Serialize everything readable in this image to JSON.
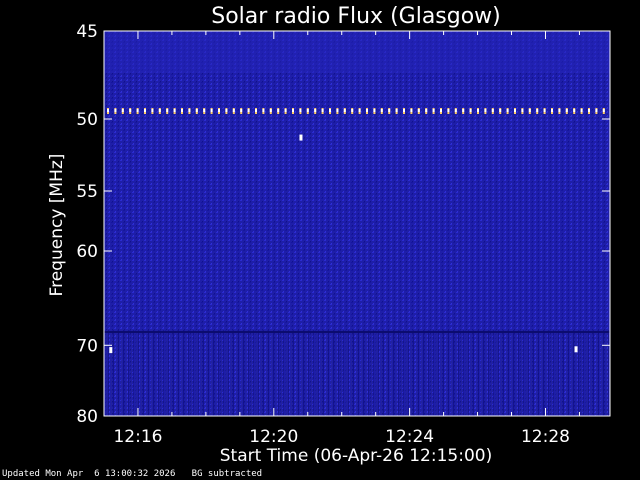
{
  "chart_data": {
    "type": "heatmap",
    "title": "Solar radio Flux (Glasgow)",
    "xlabel": "Start Time (06-Apr-26 12:15:00)",
    "ylabel_main": "Frequency ",
    "ylabel_unit": "[MHz]",
    "x_range_minutes": [
      15.0,
      29.9
    ],
    "x_ticks": [
      {
        "label": "12:16",
        "minute": 16
      },
      {
        "label": "12:20",
        "minute": 20
      },
      {
        "label": "12:24",
        "minute": 24
      },
      {
        "label": "12:28",
        "minute": 28
      }
    ],
    "y_scale": "reciprocal",
    "y_range": [
      45,
      80
    ],
    "y_ticks": [
      45,
      50,
      55,
      60,
      70,
      80
    ],
    "colormap": {
      "low": "#1a1a9e",
      "mid": "#2a2acc",
      "high": "#ffffff",
      "interference": "#ffcc66"
    },
    "features": [
      {
        "kind": "narrowband-interference-line",
        "frequency_mhz": 49.5,
        "pattern": "dotted"
      },
      {
        "kind": "spot",
        "frequency_mhz": 51.2,
        "minute": 20.8
      },
      {
        "kind": "spot",
        "frequency_mhz": 70.6,
        "minute": 15.2
      },
      {
        "kind": "spot",
        "frequency_mhz": 70.5,
        "minute": 28.9
      }
    ]
  },
  "footer": {
    "updated": "Updated Mon Apr  6 13:00:32 2026",
    "note": "BG subtracted"
  }
}
